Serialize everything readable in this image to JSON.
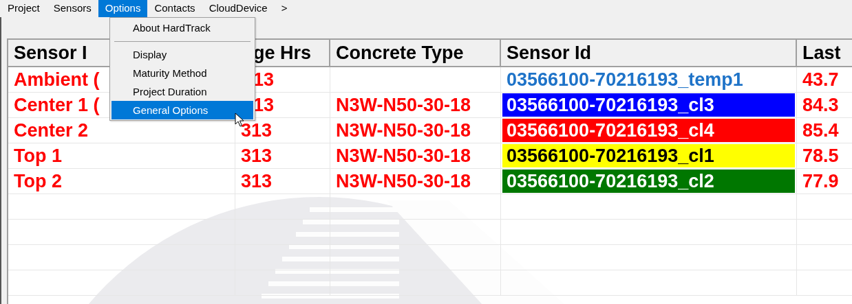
{
  "menu_bar": [
    {
      "label": "Project",
      "selected": false
    },
    {
      "label": "Sensors",
      "selected": false
    },
    {
      "label": "Options",
      "selected": true
    },
    {
      "label": "Contacts",
      "selected": false
    },
    {
      "label": "CloudDevice",
      "selected": false
    },
    {
      "label": ">",
      "selected": false
    }
  ],
  "dropdown": {
    "items": [
      {
        "kind": "item",
        "label": "About HardTrack",
        "selected": false
      },
      {
        "kind": "separator"
      },
      {
        "kind": "item",
        "label": "Display",
        "selected": false
      },
      {
        "kind": "item",
        "label": "Maturity Method",
        "selected": false
      },
      {
        "kind": "item",
        "label": "Project Duration",
        "selected": false
      },
      {
        "kind": "item",
        "label": "General Options",
        "selected": true
      }
    ]
  },
  "table": {
    "columns": [
      {
        "label": "Sensor I",
        "covered": false
      },
      {
        "label": "ge Hrs",
        "covered": true
      },
      {
        "label": "Concrete Type",
        "covered": false
      },
      {
        "label": "Sensor Id",
        "covered": false
      },
      {
        "label": "Last",
        "covered": false
      }
    ],
    "rows": [
      {
        "name": {
          "text": "Ambient (",
          "covered": false
        },
        "age": {
          "text": "13",
          "covered": true
        },
        "concrete": null,
        "sensor": {
          "text": "03566100-70216193_temp1",
          "filled": false,
          "color": "#1e73c8"
        },
        "last": "43.7"
      },
      {
        "name": {
          "text": "Center 1 (",
          "covered": false
        },
        "age": {
          "text": "13",
          "covered": true
        },
        "concrete": "N3W-N50-30-18",
        "sensor": {
          "text": "03566100-70216193_cl3",
          "filled": true,
          "color": "#0000ff"
        },
        "last": "84.3"
      },
      {
        "name": {
          "text": "Center 2",
          "covered": false
        },
        "age": {
          "text": "313",
          "covered": false
        },
        "concrete": "N3W-N50-30-18",
        "sensor": {
          "text": "03566100-70216193_cl4",
          "filled": true,
          "color": "#ff0000"
        },
        "last": "85.4"
      },
      {
        "name": {
          "text": "Top 1",
          "covered": false
        },
        "age": {
          "text": "313",
          "covered": false
        },
        "concrete": "N3W-N50-30-18",
        "sensor": {
          "text": "03566100-70216193_cl1",
          "filled": true,
          "color": "#ffff00"
        },
        "last": "78.5"
      },
      {
        "name": {
          "text": "Top 2",
          "covered": false
        },
        "age": {
          "text": "313",
          "covered": false
        },
        "concrete": "N3W-N50-30-18",
        "sensor": {
          "text": "03566100-70216193_cl2",
          "filled": true,
          "color": "#007700"
        },
        "last": "77.9"
      }
    ]
  }
}
